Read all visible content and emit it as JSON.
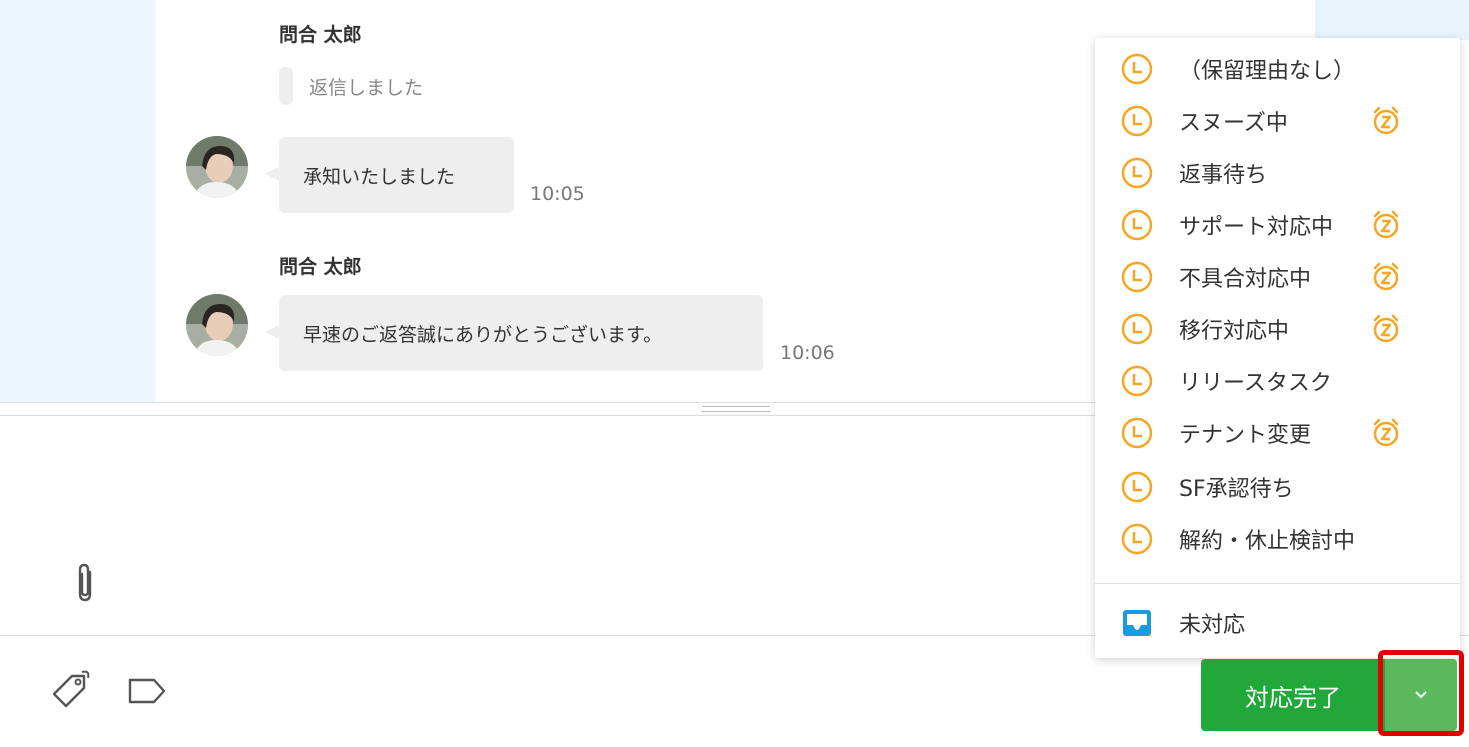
{
  "messages": [
    {
      "sender": "問合 太郎",
      "quote": "返信しました"
    },
    {
      "text": "承知いたしました",
      "time": "10:05"
    },
    {
      "sender": "問合 太郎",
      "text": "早速のご返答誠にありがとうございます。",
      "time": "10:06"
    }
  ],
  "status_menu": {
    "items": [
      {
        "label": "（保留理由なし）",
        "snooze": false
      },
      {
        "label": "スヌーズ中",
        "snooze": true
      },
      {
        "label": "返事待ち",
        "snooze": false
      },
      {
        "label": "サポート対応中",
        "snooze": true
      },
      {
        "label": "不具合対応中",
        "snooze": true
      },
      {
        "label": "移行対応中",
        "snooze": true
      },
      {
        "label": "リリースタスク",
        "snooze": false
      },
      {
        "label": "テナント変更",
        "snooze": true
      },
      {
        "label": "SF承認待ち",
        "snooze": false
      },
      {
        "label": "解約・休止検討中",
        "snooze": false
      }
    ],
    "unhandled_label": "未対応"
  },
  "actions": {
    "done_label": "対応完了"
  },
  "colors": {
    "accent_orange": "#f5a623",
    "done_green": "#22a73a",
    "caret_green": "#5cb85c",
    "inbox_blue": "#1a9be0",
    "highlight_red": "#e00000"
  },
  "icons": {
    "attach": "paperclip-icon",
    "tag": "tag-icon",
    "label": "label-icon",
    "clock": "clock-icon",
    "snooze": "alarm-snooze-icon",
    "inbox": "inbox-icon",
    "caret": "chevron-down-icon"
  }
}
